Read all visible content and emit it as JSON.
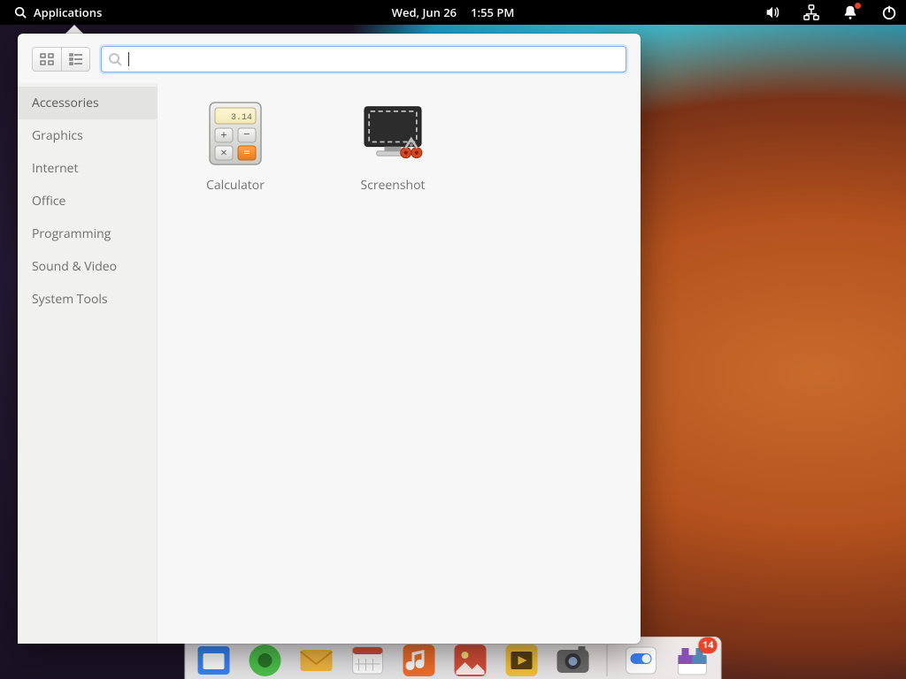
{
  "topbar": {
    "applications_label": "Applications",
    "date": "Wed, Jun 26",
    "time": "1:55 PM"
  },
  "popover": {
    "search_placeholder": "",
    "categories": [
      "Accessories",
      "Graphics",
      "Internet",
      "Office",
      "Programming",
      "Sound & Video",
      "System Tools"
    ],
    "selected_category_index": 0,
    "apps": [
      {
        "name": "Calculator",
        "icon": "calculator"
      },
      {
        "name": "Screenshot",
        "icon": "screenshot"
      }
    ]
  },
  "dock": {
    "items": [
      {
        "name": "files-icon"
      },
      {
        "name": "browser-icon"
      },
      {
        "name": "mail-icon"
      },
      {
        "name": "calendar-icon"
      },
      {
        "name": "music-icon"
      },
      {
        "name": "photos-icon"
      },
      {
        "name": "videos-icon"
      },
      {
        "name": "camera-icon"
      }
    ],
    "right_items": [
      {
        "name": "toggle-icon"
      },
      {
        "name": "software-icon",
        "badge": "14"
      }
    ]
  }
}
